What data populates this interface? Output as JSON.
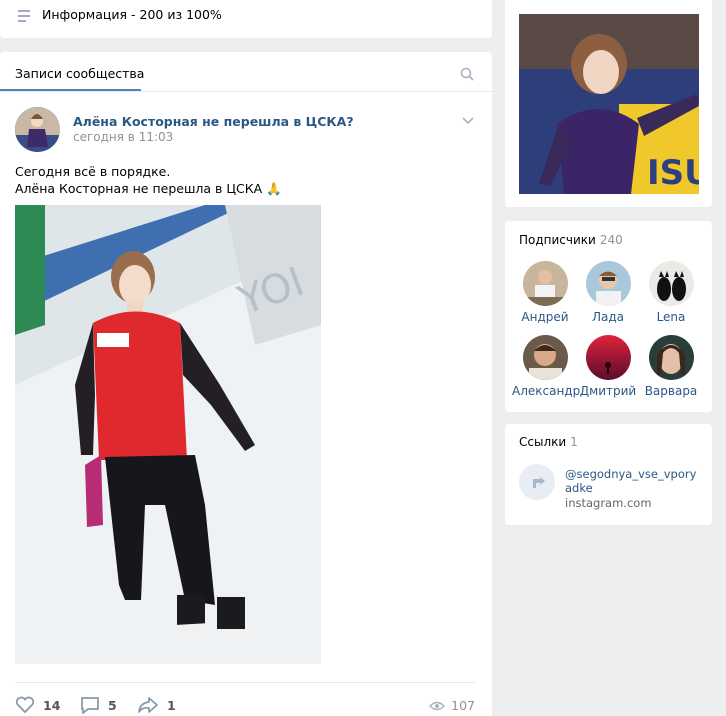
{
  "info": {
    "text": "Информация - 200 из 100%"
  },
  "wall": {
    "tab_label": "Записи сообщества"
  },
  "post": {
    "title": "Алёна Косторная не перешла в ЦСКА?",
    "time": "сегодня в 11:03",
    "text_line1": "Сегодня всё в порядке.",
    "text_line2": "Алёна Косторная не перешла в ЦСКА 🙏",
    "likes": "14",
    "comments": "5",
    "shares": "1",
    "views": "107"
  },
  "subscribers": {
    "title": "Подписчики",
    "count": "240",
    "items": [
      {
        "name": "Андрей"
      },
      {
        "name": "Лада"
      },
      {
        "name": "Lena"
      },
      {
        "name": "Александр"
      },
      {
        "name": "Дмитрий"
      },
      {
        "name": "Варвара"
      }
    ]
  },
  "links": {
    "title": "Ссылки",
    "count": "1",
    "url": "@segodnya_vse_vporyadke",
    "domain": "instagram.com"
  },
  "colors": {
    "accent": "#5181b8",
    "link": "#2a5885",
    "background": "#edeef0"
  }
}
